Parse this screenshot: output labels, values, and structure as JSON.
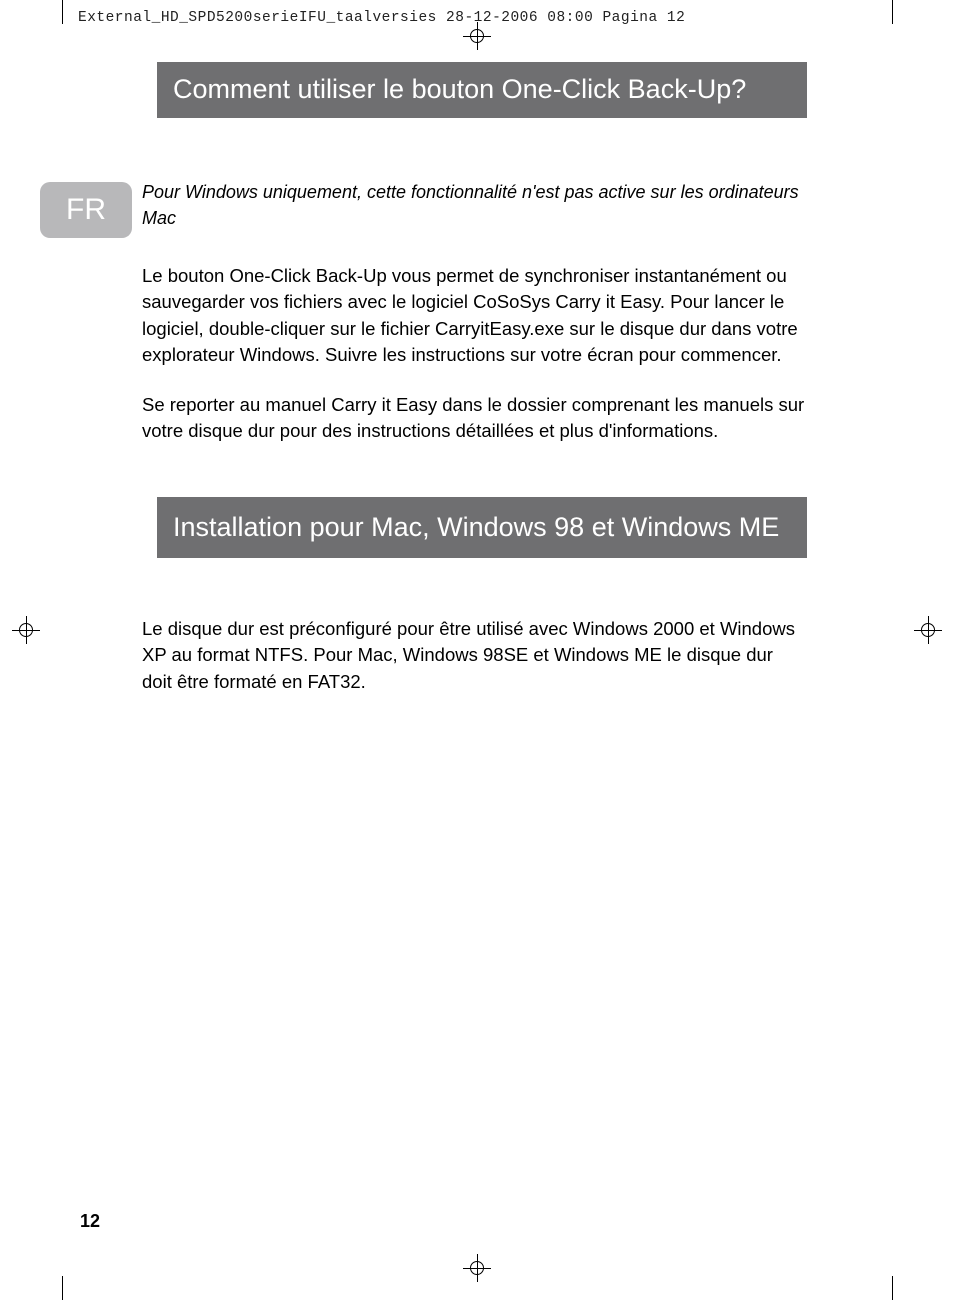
{
  "header": {
    "line": "External_HD_SPD5200serieIFU_taalversies  28-12-2006  08:00  Pagina 12"
  },
  "lang_badge": "FR",
  "section1": {
    "title": "Comment utiliser le bouton One-Click Back-Up?",
    "note": "Pour Windows uniquement, cette fonctionnalité n'est pas active sur les ordinateurs Mac",
    "p1": "Le bouton One-Click Back-Up vous permet de synchroniser instantanément ou sauvegarder vos fichiers avec le logiciel CoSoSys Carry it Easy. Pour lancer le logiciel, double-cliquer sur le fichier CarryitEasy.exe sur le disque dur dans votre explorateur Windows. Suivre les instructions sur votre écran pour commencer.",
    "p2": "Se reporter au manuel Carry it Easy dans le dossier comprenant les manuels sur votre disque dur pour des instructions détaillées et plus d'informations."
  },
  "section2": {
    "title": "Installation pour Mac, Windows 98 et  Windows ME",
    "p1": "Le disque dur est préconfiguré pour être utilisé avec Windows 2000 et Windows XP au format NTFS. Pour Mac, Windows 98SE et Windows ME le disque dur doit être formaté en FAT32."
  },
  "page_number": "12"
}
